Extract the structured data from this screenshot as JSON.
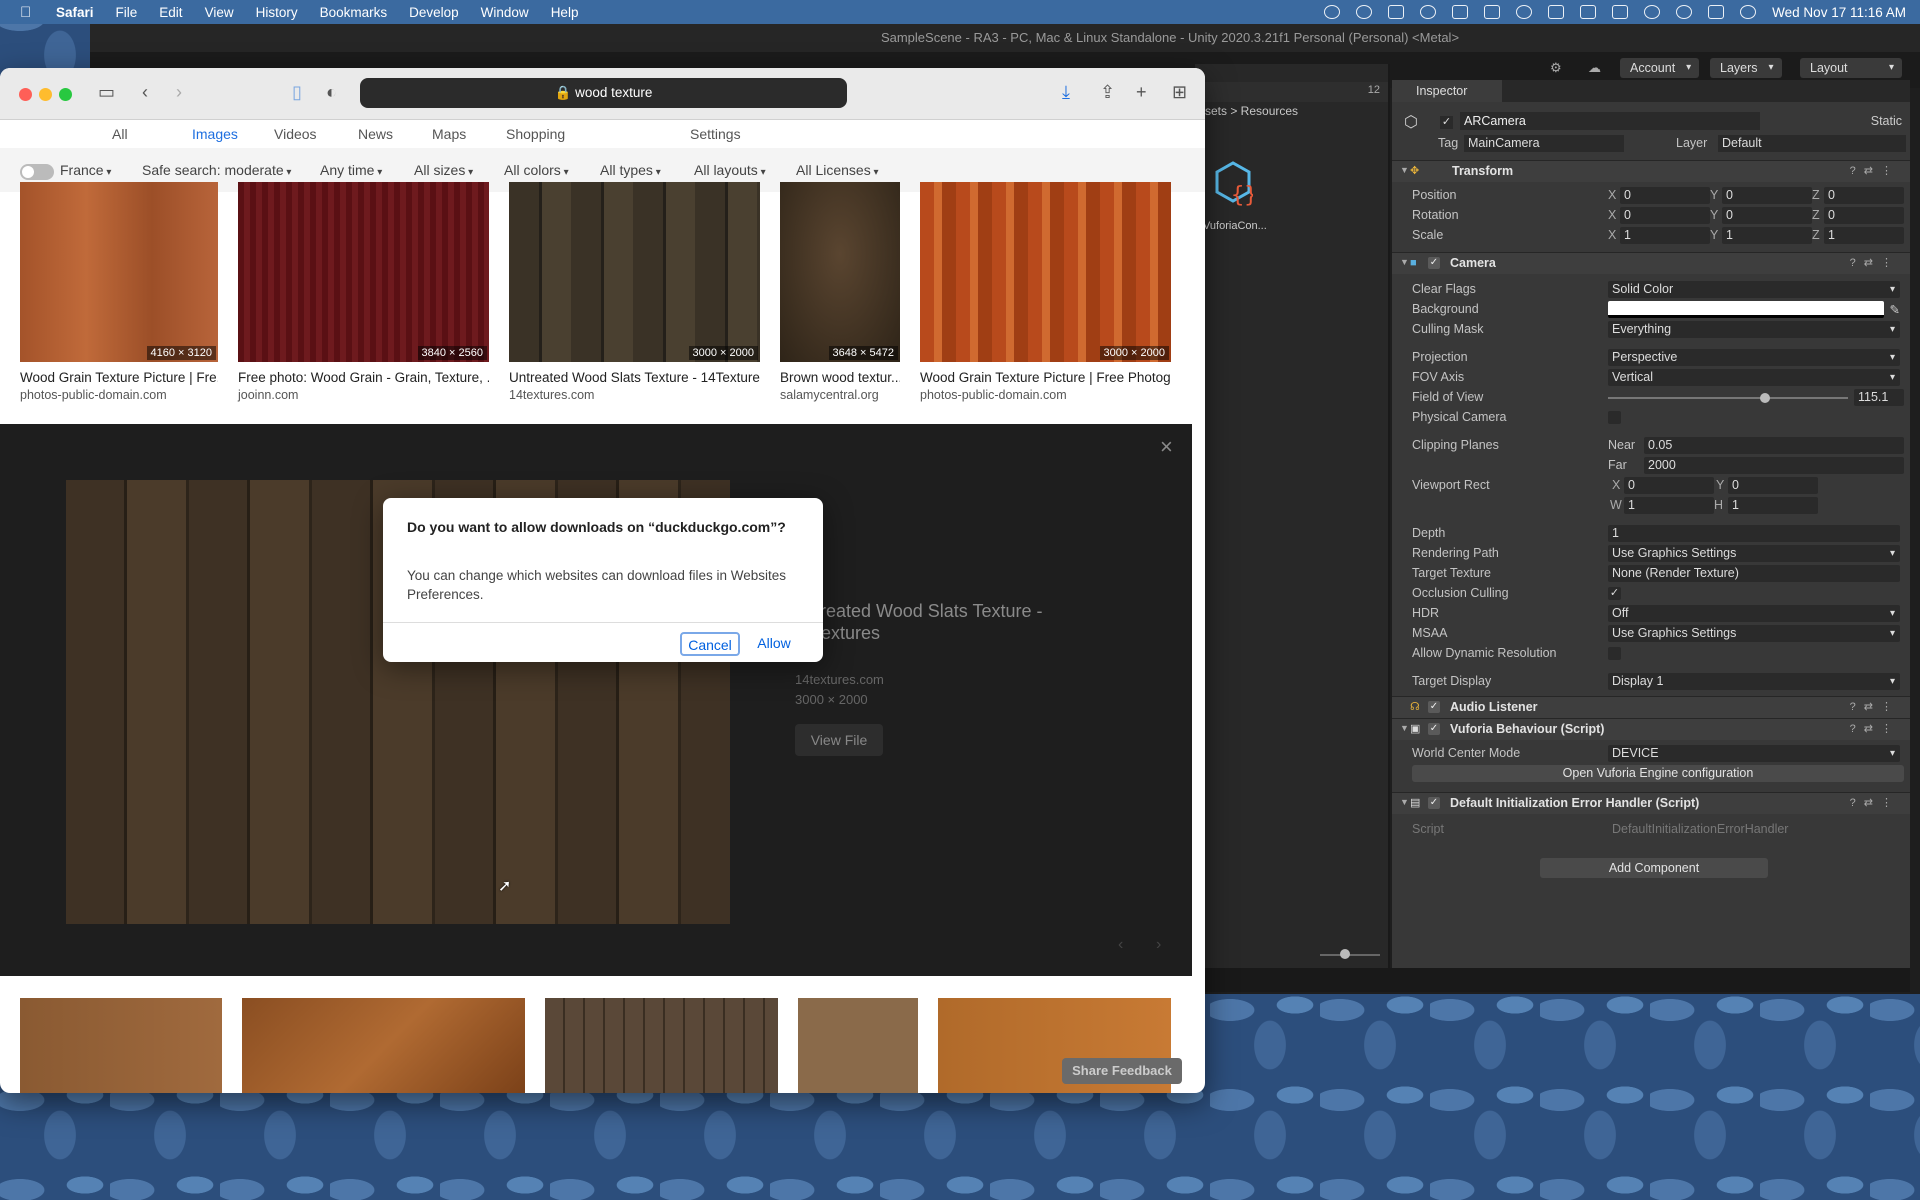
{
  "menubar": {
    "app": "Safari",
    "items": [
      "File",
      "Edit",
      "View",
      "History",
      "Bookmarks",
      "Develop",
      "Window",
      "Help"
    ],
    "clock": "Wed Nov 17  11:16 AM"
  },
  "unity": {
    "title": "SampleScene - RA3 - PC, Mac & Linux Standalone - Unity 2020.3.21f1 Personal (Personal) <Metal>",
    "account": "Account",
    "layers": "Layers",
    "layout": "Layout",
    "project": {
      "breadcrumb": "sets > Resources",
      "asset": "VuforiaCon...",
      "count": "12"
    },
    "inspector": {
      "tab": "Inspector",
      "object": "ARCamera",
      "static": "Static",
      "tag_label": "Tag",
      "tag": "MainCamera",
      "layer_label": "Layer",
      "layer": "Default",
      "transform": {
        "name": "Transform",
        "position": [
          "0",
          "0",
          "0"
        ],
        "rotation": [
          "0",
          "0",
          "0"
        ],
        "scale": [
          "1",
          "1",
          "1"
        ],
        "pos_label": "Position",
        "rot_label": "Rotation",
        "scale_label": "Scale"
      },
      "camera": {
        "name": "Camera",
        "clear_flags_l": "Clear Flags",
        "clear_flags": "Solid Color",
        "background_l": "Background",
        "culling_l": "Culling Mask",
        "culling": "Everything",
        "projection_l": "Projection",
        "projection": "Perspective",
        "fov_axis_l": "FOV Axis",
        "fov_axis": "Vertical",
        "fov_l": "Field of View",
        "fov": "115.1",
        "physical_l": "Physical Camera",
        "clip_l": "Clipping Planes",
        "near_l": "Near",
        "near": "0.05",
        "far_l": "Far",
        "far": "2000",
        "viewport_l": "Viewport Rect",
        "vx": "0",
        "vy": "0",
        "vw": "1",
        "vh": "1",
        "depth_l": "Depth",
        "depth": "1",
        "rendering_l": "Rendering Path",
        "rendering": "Use Graphics Settings",
        "target_tex_l": "Target Texture",
        "target_tex": "None (Render Texture)",
        "occlusion_l": "Occlusion Culling",
        "hdr_l": "HDR",
        "hdr": "Off",
        "msaa_l": "MSAA",
        "msaa": "Use Graphics Settings",
        "dynres_l": "Allow Dynamic Resolution",
        "target_disp_l": "Target Display",
        "target_disp": "Display 1"
      },
      "audio": "Audio Listener",
      "vuforia": "Vuforia Behaviour (Script)",
      "world_center_l": "World Center Mode",
      "world_center": "DEVICE",
      "open_config": "Open Vuforia Engine configuration",
      "handler": "Default Initialization Error Handler (Script)",
      "script_l": "Script",
      "script": "DefaultInitializationErrorHandler",
      "add_component": "Add Component"
    }
  },
  "safari": {
    "url": "wood texture",
    "tabs": [
      "All",
      "Images",
      "Videos",
      "News",
      "Maps",
      "Shopping",
      "Settings"
    ],
    "filters": [
      "France",
      "Safe search: moderate",
      "Any time",
      "All sizes",
      "All colors",
      "All types",
      "All layouts",
      "All Licenses"
    ],
    "results": [
      {
        "dim": "4160 × 3120",
        "title": "Wood Grain Texture Picture | Fre...",
        "domain": "photos-public-domain.com"
      },
      {
        "dim": "3840 × 2560",
        "title": "Free photo: Wood Grain - Grain, Texture, ...",
        "domain": "jooinn.com"
      },
      {
        "dim": "3000 × 2000",
        "title": "Untreated Wood Slats Texture - 14Textures",
        "domain": "14textures.com"
      },
      {
        "dim": "3648 × 5472",
        "title": "Brown wood textur...",
        "domain": "salamycentral.org"
      },
      {
        "dim": "3000 × 2000",
        "title": "Wood Grain Texture Picture | Free Photog...",
        "domain": "photos-public-domain.com"
      }
    ],
    "detail": {
      "title": "Untreated Wood Slats Texture - 14Textures",
      "domain": "14textures.com",
      "dim": "3000 × 2000",
      "view": "View File"
    },
    "feedback": "Share Feedback"
  },
  "dialog": {
    "title": "Do you want to allow downloads on “duckduckgo.com”?",
    "message": "You can change which websites can download files in Websites Preferences.",
    "cancel": "Cancel",
    "allow": "Allow"
  }
}
